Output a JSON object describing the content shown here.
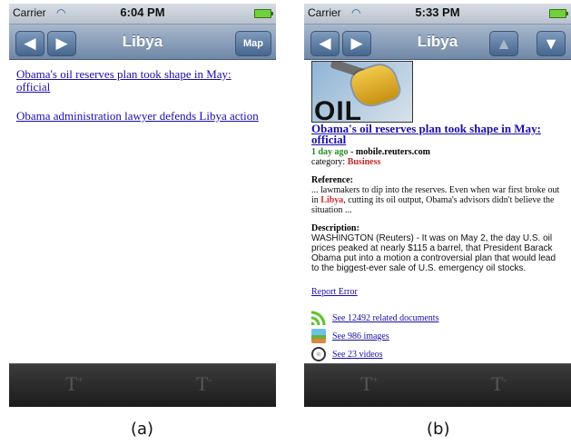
{
  "screen_a": {
    "status": {
      "carrier": "Carrier",
      "time": "6:04 PM"
    },
    "navbar": {
      "title": "Libya",
      "map_label": "Map"
    },
    "articles": [
      "Obama's oil reserves plan took shape in May: official",
      "Obama administration lawyer defends Libya action"
    ],
    "toolbar": {
      "increase_font": "T",
      "increase_mark": "+",
      "decrease_font": "T",
      "decrease_mark": "-"
    },
    "caption": "(a)"
  },
  "screen_b": {
    "status": {
      "carrier": "Carrier",
      "time": "5:33 PM"
    },
    "navbar": {
      "title": "Libya"
    },
    "article": {
      "thumbnail_text": "OIL",
      "title": "Obama's oil reserves plan took shape in May: official",
      "age": "1 day ago",
      "meta_sep": " - ",
      "source": "mobile.reuters.com",
      "category_label": "category: ",
      "category": "Business",
      "reference_label": "Reference:",
      "reference_pre": "... lawmakers to dip into the reserves. Even when war first broke out in ",
      "reference_highlight": "Libya",
      "reference_post": ", cutting its oil output, Obama's advisors didn't believe the situation ...",
      "description_label": "Description:",
      "description_text": "WASHINGTON (Reuters) - It was on May 2, the day U.S. oil prices peaked at nearly $115 a barrel, that President Barack Obama put into a motion a controversial plan that would lead to the biggest-ever sale of U.S. emergency oil stocks.",
      "report_error": "Report Error",
      "related": [
        {
          "icon": "rss-icon",
          "label": "See 12492 related documents"
        },
        {
          "icon": "images-icon",
          "label": "See 986 images"
        },
        {
          "icon": "video-icon",
          "label": "See 23 videos"
        }
      ]
    },
    "toolbar": {
      "increase_font": "T",
      "increase_mark": "+",
      "decrease_font": "T",
      "decrease_mark": "-"
    },
    "caption": "(b)"
  }
}
